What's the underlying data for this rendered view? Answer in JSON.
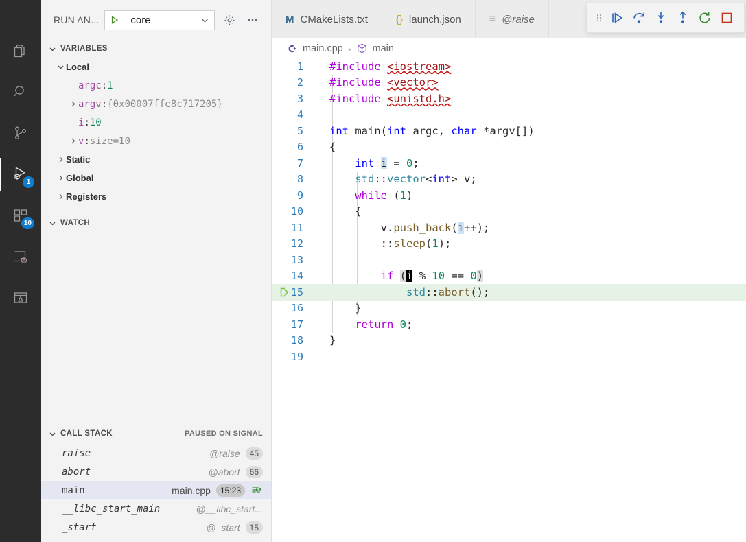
{
  "activity_bar": {
    "items": [
      {
        "name": "explorer",
        "icon": "files-icon",
        "badge": null,
        "active": false
      },
      {
        "name": "search",
        "icon": "search-icon",
        "badge": null,
        "active": false
      },
      {
        "name": "source-control",
        "icon": "source-control-icon",
        "badge": null,
        "active": false
      },
      {
        "name": "run-and-debug",
        "icon": "run-debug-icon",
        "badge": "1",
        "active": true
      },
      {
        "name": "extensions",
        "icon": "extensions-icon",
        "badge": "10",
        "active": false
      },
      {
        "name": "remote-explorer",
        "icon": "remote-icon",
        "badge": null,
        "active": false
      },
      {
        "name": "testing",
        "icon": "testing-icon",
        "badge": null,
        "active": false
      }
    ]
  },
  "sidebar": {
    "header": {
      "title": "RUN AN...",
      "launch_config": "core",
      "play_icon": "play-icon",
      "caret_icon": "chevron-down-icon",
      "gear_icon": "gear-icon",
      "more_icon": "ellipsis-icon"
    },
    "variables": {
      "title": "VARIABLES",
      "rows": [
        {
          "indent": 1,
          "twisty": "chevron-down",
          "kind": "scope",
          "name": "Local",
          "value": ""
        },
        {
          "indent": 2,
          "twisty": "none",
          "kind": "var",
          "name": "argc",
          "value": "1",
          "value_kind": "num"
        },
        {
          "indent": 2,
          "twisty": "chevron-right",
          "kind": "var",
          "name": "argv",
          "value": "{0x00007ffe8c717205}",
          "value_kind": "str"
        },
        {
          "indent": 2,
          "twisty": "none",
          "kind": "var",
          "name": "i",
          "value": "10",
          "value_kind": "num"
        },
        {
          "indent": 2,
          "twisty": "chevron-right",
          "kind": "var",
          "name": "v",
          "value": "size=10",
          "value_kind": "str"
        },
        {
          "indent": 1,
          "twisty": "chevron-right",
          "kind": "scope",
          "name": "Static",
          "value": ""
        },
        {
          "indent": 1,
          "twisty": "chevron-right",
          "kind": "scope",
          "name": "Global",
          "value": ""
        },
        {
          "indent": 1,
          "twisty": "chevron-right",
          "kind": "scope",
          "name": "Registers",
          "value": ""
        }
      ]
    },
    "watch": {
      "title": "WATCH",
      "rows": []
    },
    "call_stack": {
      "title": "CALL STACK",
      "status": "PAUSED ON SIGNAL",
      "frames": [
        {
          "name": "raise",
          "source": "@raise",
          "line": "45",
          "selected": false,
          "restart": false
        },
        {
          "name": "abort",
          "source": "@abort",
          "line": "66",
          "selected": false,
          "restart": false
        },
        {
          "name": "main",
          "source": "main.cpp",
          "line": "15:23",
          "selected": true,
          "restart": true
        },
        {
          "name": "__libc_start_main",
          "source": "@__libc_start...",
          "line": "",
          "selected": false,
          "restart": false
        },
        {
          "name": "_start",
          "source": "@_start",
          "line": "15",
          "selected": false,
          "restart": false
        }
      ]
    }
  },
  "editor": {
    "tabs": [
      {
        "label": "CMakeLists.txt",
        "icon": "cmake-icon",
        "icon_glyph": "M",
        "active": false,
        "preview": false
      },
      {
        "label": "launch.json",
        "icon": "json-icon",
        "icon_glyph": "{}",
        "active": false,
        "preview": false
      },
      {
        "label": "@raise",
        "icon": "lines-icon",
        "icon_glyph": "≡",
        "active": true,
        "preview": true
      }
    ],
    "breadcrumb": {
      "file": "main.cpp",
      "file_icon": "cpp-icon",
      "separator": "›",
      "symbol": "main",
      "symbol_icon": "cube-icon"
    },
    "current_line": 15,
    "lines": [
      {
        "n": "1",
        "tokens": [
          {
            "t": "#include ",
            "c": "t-pre"
          },
          {
            "t": "<iostream>",
            "c": "t-inc squig"
          }
        ]
      },
      {
        "n": "2",
        "tokens": [
          {
            "t": "#include ",
            "c": "t-pre"
          },
          {
            "t": "<vector>",
            "c": "t-inc squig"
          }
        ]
      },
      {
        "n": "3",
        "tokens": [
          {
            "t": "#include ",
            "c": "t-pre"
          },
          {
            "t": "<unistd.h>",
            "c": "t-inc squig"
          }
        ]
      },
      {
        "n": "4",
        "tokens": []
      },
      {
        "n": "5",
        "tokens": [
          {
            "t": "int ",
            "c": "t-kw"
          },
          {
            "t": "main",
            "c": "t-plain"
          },
          {
            "t": "(",
            "c": "t-punct"
          },
          {
            "t": "int ",
            "c": "t-kw"
          },
          {
            "t": "argc",
            "c": "t-plain"
          },
          {
            "t": ", ",
            "c": "t-punct"
          },
          {
            "t": "char ",
            "c": "t-kw"
          },
          {
            "t": "*argv[])",
            "c": "t-plain"
          }
        ]
      },
      {
        "n": "6",
        "tokens": [
          {
            "t": "{",
            "c": "t-punct"
          }
        ]
      },
      {
        "n": "7",
        "tokens": [
          {
            "t": "    ",
            "c": "t-plain"
          },
          {
            "t": "int ",
            "c": "t-kw"
          },
          {
            "t": "i",
            "c": "t-plain sel-i"
          },
          {
            "t": " = ",
            "c": "t-punct"
          },
          {
            "t": "0",
            "c": "t-num"
          },
          {
            "t": ";",
            "c": "t-punct"
          }
        ]
      },
      {
        "n": "8",
        "tokens": [
          {
            "t": "    ",
            "c": "t-plain"
          },
          {
            "t": "std",
            "c": "t-ns"
          },
          {
            "t": "::",
            "c": "t-punct"
          },
          {
            "t": "vector",
            "c": "t-ns"
          },
          {
            "t": "<",
            "c": "t-punct"
          },
          {
            "t": "int",
            "c": "t-kw"
          },
          {
            "t": "> v;",
            "c": "t-plain"
          }
        ]
      },
      {
        "n": "9",
        "tokens": [
          {
            "t": "    ",
            "c": "t-plain"
          },
          {
            "t": "while",
            "c": "t-kwc"
          },
          {
            "t": " (",
            "c": "t-punct"
          },
          {
            "t": "1",
            "c": "t-num"
          },
          {
            "t": ")",
            "c": "t-punct"
          }
        ]
      },
      {
        "n": "10",
        "tokens": [
          {
            "t": "    {",
            "c": "t-punct"
          }
        ]
      },
      {
        "n": "11",
        "tokens": [
          {
            "t": "        v",
            "c": "t-plain"
          },
          {
            "t": ".",
            "c": "t-punct"
          },
          {
            "t": "push_back",
            "c": "t-fn"
          },
          {
            "t": "(",
            "c": "t-punct"
          },
          {
            "t": "i",
            "c": "t-plain sel-i"
          },
          {
            "t": "++);",
            "c": "t-punct"
          }
        ]
      },
      {
        "n": "12",
        "tokens": [
          {
            "t": "        ",
            "c": "t-plain"
          },
          {
            "t": "::",
            "c": "t-punct"
          },
          {
            "t": "sleep",
            "c": "t-fn"
          },
          {
            "t": "(",
            "c": "t-punct"
          },
          {
            "t": "1",
            "c": "t-num"
          },
          {
            "t": ");",
            "c": "t-punct"
          }
        ]
      },
      {
        "n": "13",
        "tokens": []
      },
      {
        "n": "14",
        "tokens": [
          {
            "t": "        ",
            "c": "t-plain"
          },
          {
            "t": "if",
            "c": "t-kwc"
          },
          {
            "t": " ",
            "c": "t-plain"
          },
          {
            "t": "(",
            "c": "t-punct brkt"
          },
          {
            "t": "i",
            "c": "cursor-i"
          },
          {
            "t": " % ",
            "c": "t-punct"
          },
          {
            "t": "10",
            "c": "t-num"
          },
          {
            "t": " == ",
            "c": "t-punct"
          },
          {
            "t": "0",
            "c": "t-num"
          },
          {
            "t": ")",
            "c": "t-punct brkt"
          }
        ]
      },
      {
        "n": "15",
        "tokens": [
          {
            "t": "            ",
            "c": "t-plain"
          },
          {
            "t": "std",
            "c": "t-ns"
          },
          {
            "t": "::",
            "c": "t-punct"
          },
          {
            "t": "abort",
            "c": "t-fn"
          },
          {
            "t": "();",
            "c": "t-punct"
          }
        ]
      },
      {
        "n": "16",
        "tokens": [
          {
            "t": "    }",
            "c": "t-punct"
          }
        ]
      },
      {
        "n": "17",
        "tokens": [
          {
            "t": "    ",
            "c": "t-plain"
          },
          {
            "t": "return",
            "c": "t-kwc"
          },
          {
            "t": " ",
            "c": "t-plain"
          },
          {
            "t": "0",
            "c": "t-num"
          },
          {
            "t": ";",
            "c": "t-punct"
          }
        ]
      },
      {
        "n": "18",
        "tokens": [
          {
            "t": "}",
            "c": "t-punct"
          }
        ]
      },
      {
        "n": "19",
        "tokens": []
      }
    ]
  },
  "debug_toolbar": {
    "buttons": [
      {
        "name": "drag-handle",
        "icon": "grip-icon",
        "title": ""
      },
      {
        "name": "continue",
        "icon": "continue-icon",
        "title": "Continue"
      },
      {
        "name": "step-over",
        "icon": "step-over-icon",
        "title": "Step Over"
      },
      {
        "name": "step-into",
        "icon": "step-into-icon",
        "title": "Step Into"
      },
      {
        "name": "step-out",
        "icon": "step-out-icon",
        "title": "Step Out"
      },
      {
        "name": "restart",
        "icon": "restart-icon",
        "title": "Restart"
      },
      {
        "name": "stop",
        "icon": "stop-icon",
        "title": "Stop"
      }
    ]
  },
  "colors": {
    "accent_blue": "#0f7ccf",
    "current_line_green": "#e6f2e6",
    "selected_frame": "#e4e6f1",
    "stop_red": "#c4351b",
    "restart_green": "#388a34",
    "activity_bar_bg": "#2c2c2c",
    "sidebar_bg": "#f3f3f3"
  }
}
